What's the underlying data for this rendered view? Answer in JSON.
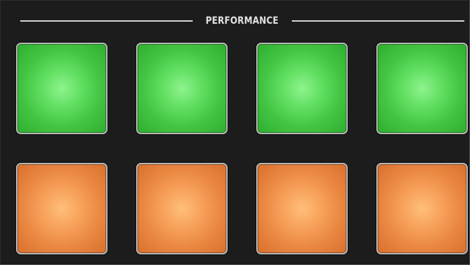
{
  "section": {
    "title": "PERFORMANCE"
  },
  "colors": {
    "panel_background": "#1c1c1c",
    "pad_border": "#b9b9b9",
    "header_line": "#d6d6d6",
    "green_pad": "#55d655",
    "orange_pad": "#f09a52"
  },
  "pads": {
    "rows": [
      {
        "row": 1,
        "color": "green",
        "count": 4
      },
      {
        "row": 2,
        "color": "orange",
        "count": 4
      }
    ]
  }
}
